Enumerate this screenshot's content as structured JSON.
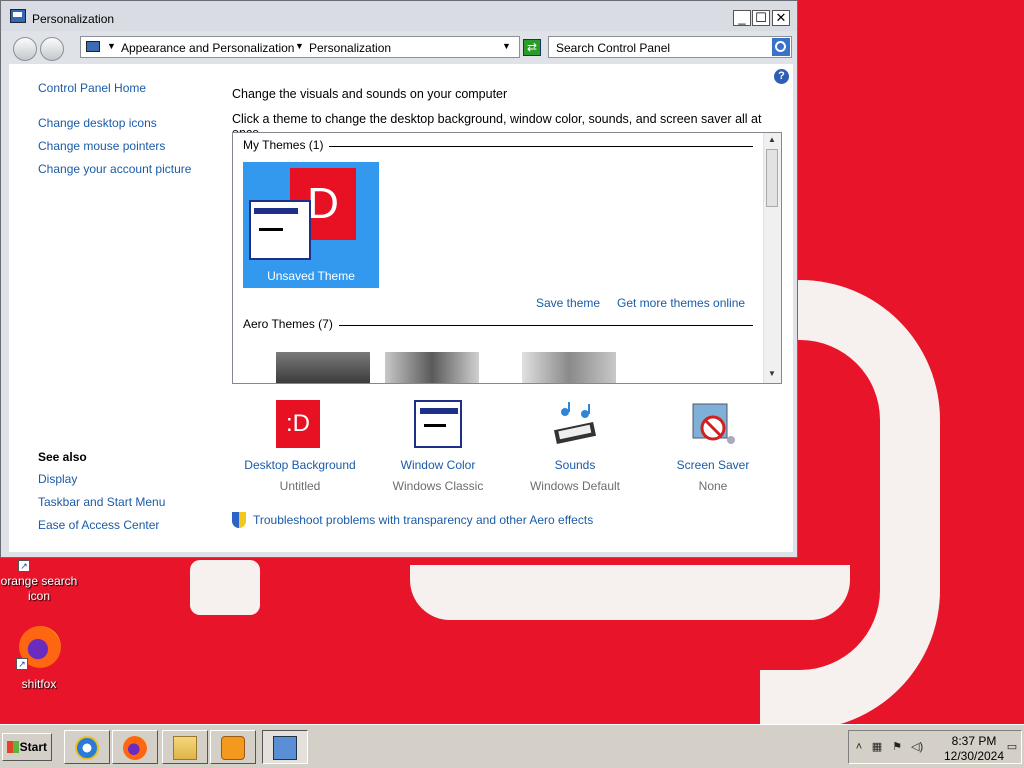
{
  "window": {
    "title": "Personalization",
    "buttons": {
      "minimize": "_",
      "maximize": "☐",
      "close": "✕"
    }
  },
  "navbar": {
    "breadcrumb": [
      "Appearance and Personalization",
      "Personalization"
    ],
    "search_placeholder": "Search Control Panel"
  },
  "sidebar": {
    "home": "Control Panel Home",
    "links": [
      "Change desktop icons",
      "Change mouse pointers",
      "Change your account picture"
    ],
    "see_also_label": "See also",
    "see_also": [
      "Display",
      "Taskbar and Start Menu",
      "Ease of Access Center"
    ]
  },
  "main": {
    "heading": "Change the visuals and sounds on your computer",
    "subheading": "Click a theme to change the desktop background, window color, sounds, and screen saver all at once.",
    "my_themes_label": "My Themes (1)",
    "aero_themes_label": "Aero Themes (7)",
    "selected_theme": {
      "name": "Unsaved Theme",
      "glyph": "D",
      "progress_selected": true
    },
    "save_theme_link": "Save theme",
    "more_themes_link": "Get more themes online",
    "bottom_items": [
      {
        "label": "Desktop Background",
        "value": "Untitled",
        "icon": "desktop-background-icon",
        "glyph": ":D"
      },
      {
        "label": "Window Color",
        "value": "Windows Classic",
        "icon": "window-color-icon"
      },
      {
        "label": "Sounds",
        "value": "Windows Default",
        "icon": "sounds-icon"
      },
      {
        "label": "Screen Saver",
        "value": "None",
        "icon": "screen-saver-icon"
      }
    ],
    "troubleshoot_link": "Troubleshoot problems with transparency and other Aero effects",
    "help": "?"
  },
  "desktop": {
    "icons": [
      {
        "label": "orange search icon"
      },
      {
        "label": "shitfox"
      }
    ]
  },
  "taskbar": {
    "start_label": "Start",
    "time": "8:37 PM",
    "date": "12/30/2024"
  },
  "colors": {
    "wallpaper": "#e8142a",
    "link": "#1a5ba8",
    "selection": "#3399ee"
  }
}
